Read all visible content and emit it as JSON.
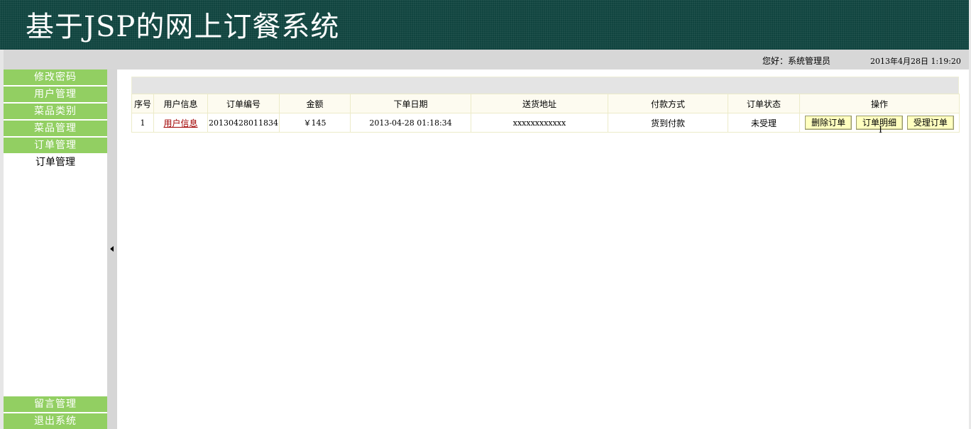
{
  "header": {
    "title": "基于JSP的网上订餐系统"
  },
  "topbar": {
    "greeting": "您好：系统管理员",
    "datetime": "2013年4月28日  1:19:20"
  },
  "sidebar": {
    "items": [
      {
        "label": "修改密码"
      },
      {
        "label": "用户管理"
      },
      {
        "label": "菜品类别"
      },
      {
        "label": "菜品管理"
      },
      {
        "label": "订单管理"
      }
    ],
    "sub_items": [
      {
        "label": "订单管理"
      }
    ],
    "bottom_items": [
      {
        "label": "留言管理"
      },
      {
        "label": "退出系统"
      }
    ]
  },
  "orders_table": {
    "headers": [
      "序号",
      "用户信息",
      "订单编号",
      "金额",
      "下单日期",
      "送货地址",
      "付款方式",
      "订单状态",
      "操作"
    ],
    "rows": [
      {
        "index": "1",
        "user_info": "用户信息",
        "order_no": "20130428011834",
        "amount": "￥145",
        "date": "2013-04-28 01:18:34",
        "address": "xxxxxxxxxxxx",
        "payment": "货到付款",
        "status": "未受理",
        "actions": {
          "delete": "删除订单",
          "detail": "订单明细",
          "accept": "受理订单"
        }
      }
    ]
  },
  "colors": {
    "header_bg": "#10443f",
    "menu_green": "#92cf62",
    "topbar_bg": "#d7d7d7",
    "button_bg": "#ffffc0",
    "link_red": "#a00000"
  },
  "icons": {
    "splitter": "collapse-left-arrow-icon",
    "cursor": "text-cursor-icon"
  }
}
